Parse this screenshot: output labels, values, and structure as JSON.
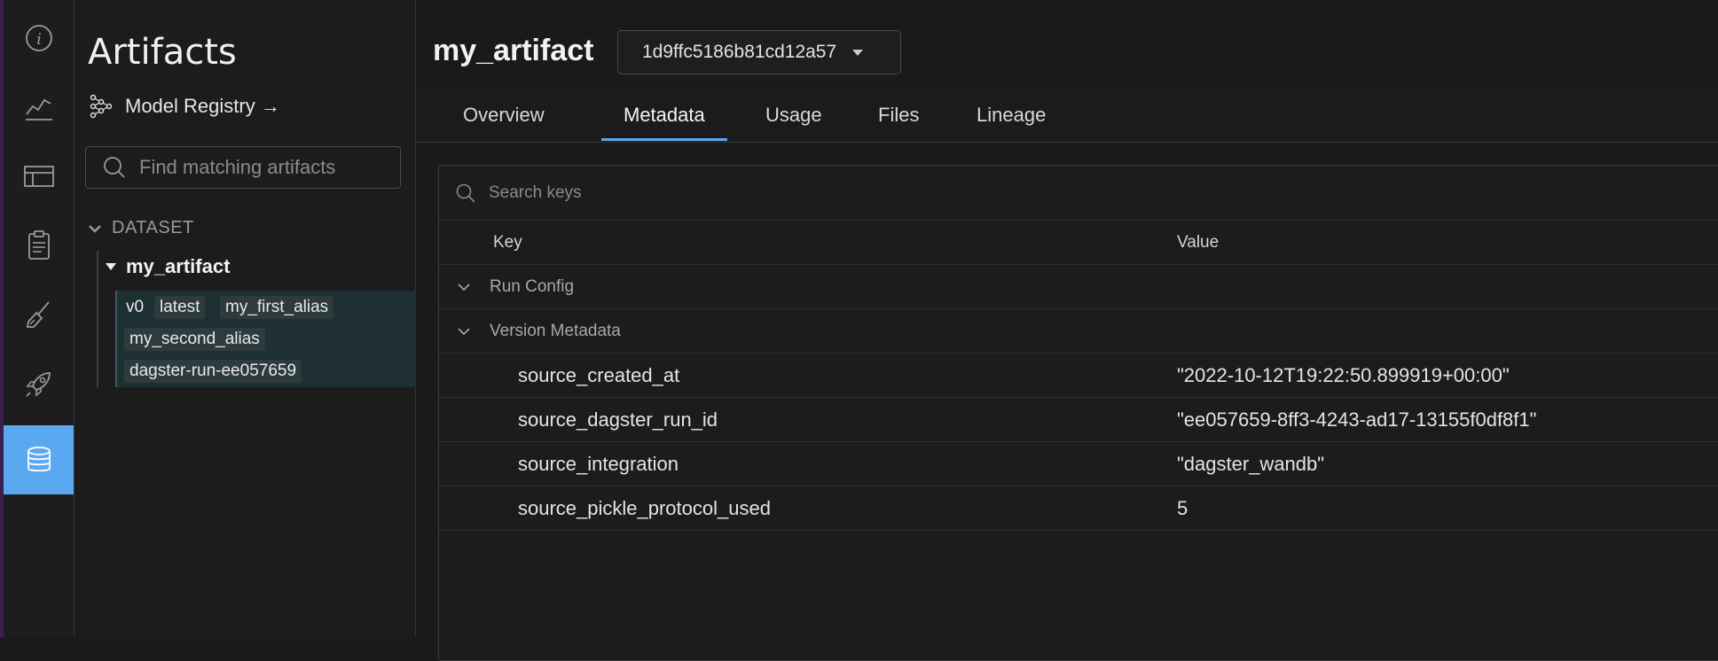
{
  "rail": {
    "items": [
      {
        "icon": "info-icon"
      },
      {
        "icon": "chart-icon"
      },
      {
        "icon": "table-icon"
      },
      {
        "icon": "clipboard-icon"
      },
      {
        "icon": "brush-icon"
      },
      {
        "icon": "rocket-icon"
      },
      {
        "icon": "database-icon",
        "active": true
      }
    ]
  },
  "sidebar": {
    "title": "Artifacts",
    "registry_link": "Model Registry →",
    "search_placeholder": "Find matching artifacts",
    "group": "DATASET",
    "artifact": "my_artifact",
    "version": {
      "label": "v0",
      "aliases": [
        "latest",
        "my_first_alias",
        "my_second_alias",
        "dagster-run-ee057659"
      ]
    }
  },
  "header": {
    "artifact_name": "my_artifact",
    "version_hash": "1d9ffc5186b81cd12a57"
  },
  "tabs": [
    "Overview",
    "Metadata",
    "Usage",
    "Files",
    "Lineage"
  ],
  "active_tab": "Metadata",
  "metadata": {
    "search_placeholder": "Search keys",
    "columns": {
      "key": "Key",
      "value": "Value"
    },
    "sections": [
      "Run Config",
      "Version Metadata"
    ],
    "rows": [
      {
        "key": "source_created_at",
        "value": "\"2022-10-12T19:22:50.899919+00:00\""
      },
      {
        "key": "source_dagster_run_id",
        "value": "\"ee057659-8ff3-4243-ad17-13155f0df8f1\""
      },
      {
        "key": "source_integration",
        "value": "\"dagster_wandb\""
      },
      {
        "key": "source_pickle_protocol_used",
        "value": "5"
      }
    ]
  },
  "colors": {
    "accent": "#5aa9f0",
    "background": "#1a1a1a",
    "version_highlight": "#1f3035"
  }
}
